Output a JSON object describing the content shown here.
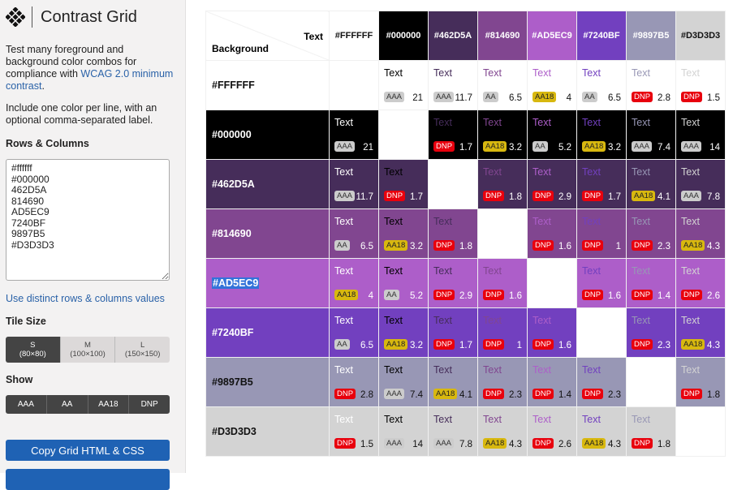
{
  "sidebar": {
    "title": "Contrast Grid",
    "desc1": "Test many foreground and background color combos for compliance with ",
    "desc_link": "WCAG 2.0 minimum contrast",
    "desc_end": ".",
    "desc2": "Include one color per line, with an optional comma-separated label.",
    "rows_heading": "Rows & Columns",
    "textarea_value": "#ffffff\n#000000\n462D5A\n814690\nAD5EC9\n7240BF\n9897B5\n#D3D3D3",
    "distinct_link": "Use distinct rows & columns values",
    "tile_heading": "Tile Size",
    "tile_sizes": [
      {
        "label": "S",
        "sub": "(80×80)",
        "active": true
      },
      {
        "label": "M",
        "sub": "(100×100)",
        "active": false
      },
      {
        "label": "L",
        "sub": "(150×150)",
        "active": false
      }
    ],
    "show_heading": "Show",
    "show_options": [
      "AAA",
      "AA",
      "AA18",
      "DNP"
    ],
    "copy_button": "Copy Grid HTML & CSS"
  },
  "grid": {
    "corner_text": "Text",
    "corner_bg": "Background",
    "sample_text": "Text",
    "selected_row": "#AD5EC9",
    "colors": [
      {
        "label": "#FFFFFF",
        "hex": "#FFFFFF",
        "ink": "#111111"
      },
      {
        "label": "#000000",
        "hex": "#000000",
        "ink": "#FFFFFF"
      },
      {
        "label": "#462D5A",
        "hex": "#462D5A",
        "ink": "#FFFFFF"
      },
      {
        "label": "#814690",
        "hex": "#814690",
        "ink": "#FFFFFF"
      },
      {
        "label": "#AD5EC9",
        "hex": "#AD5EC9",
        "ink": "#FFFFFF"
      },
      {
        "label": "#7240BF",
        "hex": "#7240BF",
        "ink": "#FFFFFF"
      },
      {
        "label": "#9897B5",
        "hex": "#9897B5",
        "ink": "#FFFFFF"
      },
      {
        "label": "#D3D3D3",
        "hex": "#D3D3D3",
        "ink": "#111111"
      }
    ],
    "row_label_ink": [
      "#111111",
      "#FFFFFF",
      "#FFFFFF",
      "#FFFFFF",
      "#FFFFFF",
      "#FFFFFF",
      "#111111",
      "#111111"
    ],
    "cells": [
      [
        null,
        [
          "AAA",
          "21"
        ],
        [
          "AAA",
          "11.7"
        ],
        [
          "AA",
          "6.5"
        ],
        [
          "AA18",
          "4"
        ],
        [
          "AA",
          "6.5"
        ],
        [
          "DNP",
          "2.8"
        ],
        [
          "DNP",
          "1.5"
        ]
      ],
      [
        [
          "AAA",
          "21"
        ],
        null,
        [
          "DNP",
          "1.7"
        ],
        [
          "AA18",
          "3.2"
        ],
        [
          "AA",
          "5.2"
        ],
        [
          "AA18",
          "3.2"
        ],
        [
          "AAA",
          "7.4"
        ],
        [
          "AAA",
          "14"
        ]
      ],
      [
        [
          "AAA",
          "11.7"
        ],
        [
          "DNP",
          "1.7"
        ],
        null,
        [
          "DNP",
          "1.8"
        ],
        [
          "DNP",
          "2.9"
        ],
        [
          "DNP",
          "1.7"
        ],
        [
          "AA18",
          "4.1"
        ],
        [
          "AAA",
          "7.8"
        ]
      ],
      [
        [
          "AA",
          "6.5"
        ],
        [
          "AA18",
          "3.2"
        ],
        [
          "DNP",
          "1.8"
        ],
        null,
        [
          "DNP",
          "1.6"
        ],
        [
          "DNP",
          "1"
        ],
        [
          "DNP",
          "2.3"
        ],
        [
          "AA18",
          "4.3"
        ]
      ],
      [
        [
          "AA18",
          "4"
        ],
        [
          "AA",
          "5.2"
        ],
        [
          "DNP",
          "2.9"
        ],
        [
          "DNP",
          "1.6"
        ],
        null,
        [
          "DNP",
          "1.6"
        ],
        [
          "DNP",
          "1.4"
        ],
        [
          "DNP",
          "2.6"
        ]
      ],
      [
        [
          "AA",
          "6.5"
        ],
        [
          "AA18",
          "3.2"
        ],
        [
          "DNP",
          "1.7"
        ],
        [
          "DNP",
          "1"
        ],
        [
          "DNP",
          "1.6"
        ],
        null,
        [
          "DNP",
          "2.3"
        ],
        [
          "AA18",
          "4.3"
        ]
      ],
      [
        [
          "DNP",
          "2.8"
        ],
        [
          "AAA",
          "7.4"
        ],
        [
          "AA18",
          "4.1"
        ],
        [
          "DNP",
          "2.3"
        ],
        [
          "DNP",
          "1.4"
        ],
        [
          "DNP",
          "2.3"
        ],
        null,
        [
          "DNP",
          "1.8"
        ]
      ],
      [
        [
          "DNP",
          "1.5"
        ],
        [
          "AAA",
          "14"
        ],
        [
          "AAA",
          "7.8"
        ],
        [
          "AA18",
          "4.3"
        ],
        [
          "DNP",
          "2.6"
        ],
        [
          "AA18",
          "4.3"
        ],
        [
          "DNP",
          "1.8"
        ],
        null
      ]
    ]
  }
}
